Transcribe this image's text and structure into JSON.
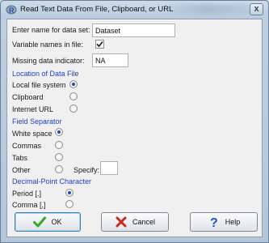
{
  "window": {
    "title": "Read Text Data From File, Clipboard, or URL",
    "close_glyph": "x"
  },
  "form": {
    "dataset_name_label": "Enter name for data set:",
    "dataset_name_value": "Dataset",
    "variable_names_label": "Variable names in file:",
    "variable_names_checked": true,
    "missing_label": "Missing data indicator:",
    "missing_value": "NA"
  },
  "location": {
    "heading": "Location of Data File",
    "options": [
      {
        "label": "Local file system",
        "selected": true
      },
      {
        "label": "Clipboard",
        "selected": false
      },
      {
        "label": "Internet URL",
        "selected": false
      }
    ]
  },
  "separator": {
    "heading": "Field Separator",
    "options": [
      {
        "label": "White space",
        "selected": true
      },
      {
        "label": "Commas",
        "selected": false
      },
      {
        "label": "Tabs",
        "selected": false
      },
      {
        "label": "Other",
        "selected": false
      }
    ],
    "specify_label": "Specify:",
    "specify_value": ""
  },
  "decimal": {
    "heading": "Decimal-Point Character",
    "options": [
      {
        "label": "Period [.]",
        "selected": true
      },
      {
        "label": "Comma [,]",
        "selected": false
      }
    ]
  },
  "buttons": {
    "ok": "OK",
    "cancel": "Cancel",
    "help": "Help"
  },
  "icons": {
    "app": "r-app-icon",
    "ok": "checkmark-icon",
    "cancel": "cross-icon",
    "help": "question-mark-icon"
  },
  "colors": {
    "section_heading": "#1f3fd0",
    "radio_selected": "#1c4fb8",
    "ok_check": "#3aa52e",
    "cancel_cross": "#d0281c",
    "help_question": "#2450c8"
  }
}
